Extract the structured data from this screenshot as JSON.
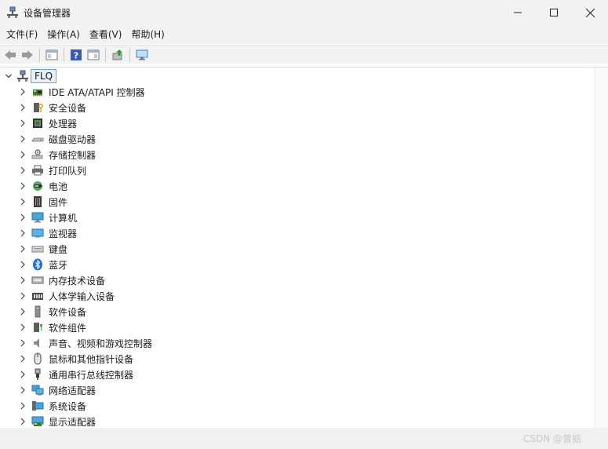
{
  "window": {
    "title": "设备管理器"
  },
  "menu": [
    {
      "label": "文件(F)"
    },
    {
      "label": "操作(A)"
    },
    {
      "label": "查看(V)"
    },
    {
      "label": "帮助(H)"
    }
  ],
  "toolbar_icons": [
    "back-arrow-icon",
    "forward-arrow-icon",
    "properties-pane-icon",
    "help-icon",
    "show-hide-tree-icon",
    "update-driver-icon",
    "scan-hardware-icon"
  ],
  "tree": {
    "root": {
      "label": "FLQ",
      "icon": "computer-network-icon"
    },
    "categories": [
      {
        "label": "IDE ATA/ATAPI 控制器",
        "icon": "ide-controller-icon"
      },
      {
        "label": "安全设备",
        "icon": "security-device-icon"
      },
      {
        "label": "处理器",
        "icon": "processor-icon"
      },
      {
        "label": "磁盘驱动器",
        "icon": "disk-drive-icon"
      },
      {
        "label": "存储控制器",
        "icon": "storage-controller-icon"
      },
      {
        "label": "打印队列",
        "icon": "printer-icon"
      },
      {
        "label": "电池",
        "icon": "battery-icon"
      },
      {
        "label": "固件",
        "icon": "firmware-icon"
      },
      {
        "label": "计算机",
        "icon": "computer-icon"
      },
      {
        "label": "监视器",
        "icon": "monitor-icon"
      },
      {
        "label": "键盘",
        "icon": "keyboard-icon"
      },
      {
        "label": "蓝牙",
        "icon": "bluetooth-icon"
      },
      {
        "label": "内存技术设备",
        "icon": "memory-device-icon"
      },
      {
        "label": "人体学输入设备",
        "icon": "hid-icon"
      },
      {
        "label": "软件设备",
        "icon": "software-device-icon"
      },
      {
        "label": "软件组件",
        "icon": "software-component-icon"
      },
      {
        "label": "声音、视频和游戏控制器",
        "icon": "speaker-icon"
      },
      {
        "label": "鼠标和其他指针设备",
        "icon": "mouse-icon"
      },
      {
        "label": "通用串行总线控制器",
        "icon": "usb-icon"
      },
      {
        "label": "网络适配器",
        "icon": "network-adapter-icon"
      },
      {
        "label": "系统设备",
        "icon": "system-device-icon"
      },
      {
        "label": "显示适配器",
        "icon": "display-adapter-icon"
      }
    ]
  },
  "watermark": "CSDN @曾掂"
}
